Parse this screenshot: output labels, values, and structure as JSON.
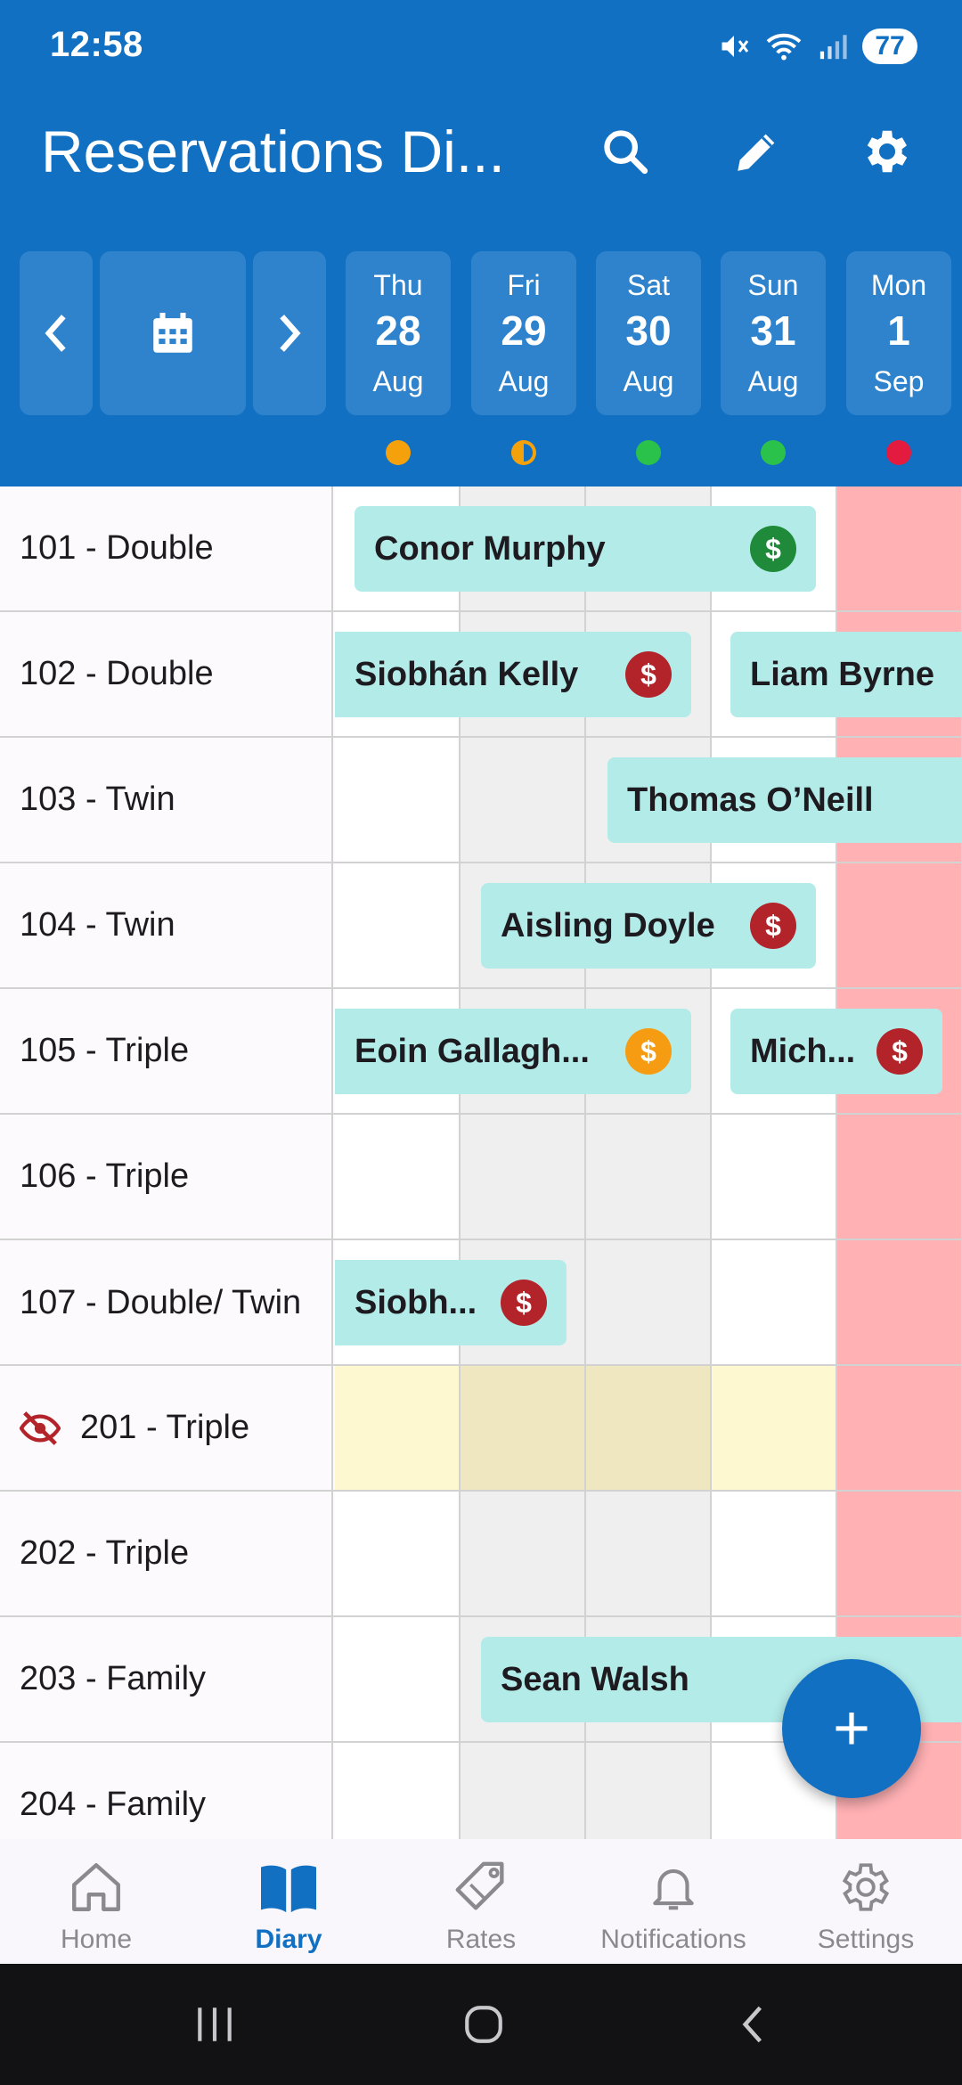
{
  "status_bar": {
    "time": "12:58",
    "battery": "77"
  },
  "app_bar": {
    "title": "Reservations Di..."
  },
  "days": [
    {
      "name": "Thu",
      "num": "28",
      "month": "Aug",
      "dot_color": "#f5a10c",
      "dot_style": "full"
    },
    {
      "name": "Fri",
      "num": "29",
      "month": "Aug",
      "dot_color": "#f5a10c",
      "dot_style": "half"
    },
    {
      "name": "Sat",
      "num": "30",
      "month": "Aug",
      "dot_color": "#2ac24a",
      "dot_style": "full"
    },
    {
      "name": "Sun",
      "num": "31",
      "month": "Aug",
      "dot_color": "#2ac24a",
      "dot_style": "full"
    },
    {
      "name": "Mon",
      "num": "1",
      "month": "Sep",
      "dot_color": "#e31b3f",
      "dot_style": "full"
    }
  ],
  "rooms": [
    {
      "label": "101 - Double"
    },
    {
      "label": "102 - Double"
    },
    {
      "label": "103 - Twin"
    },
    {
      "label": "104 - Twin"
    },
    {
      "label": "105 - Triple"
    },
    {
      "label": "106 - Triple"
    },
    {
      "label": "107 - Double/ Twin"
    },
    {
      "label": "201 - Triple",
      "hidden_icon": "eye-off-icon"
    },
    {
      "label": "202 - Triple"
    },
    {
      "label": "203 - Family"
    },
    {
      "label": "204 - Family"
    }
  ],
  "bookings": [
    {
      "guest": "Conor Murphy",
      "payment_color": "#1f8a3a",
      "payment_symbol": "$"
    },
    {
      "guest": "Siobhán Kelly",
      "payment_color": "#b3232a",
      "payment_symbol": "$"
    },
    {
      "guest": "Liam Byrne"
    },
    {
      "guest": "Thomas O’Neill"
    },
    {
      "guest": "Aisling Doyle",
      "payment_color": "#b3232a",
      "payment_symbol": "$"
    },
    {
      "guest": "Eoin Gallagh...",
      "payment_color": "#f59c12",
      "payment_symbol": "$"
    },
    {
      "guest": "Mich...",
      "payment_color": "#b3232a",
      "payment_symbol": "$"
    },
    {
      "guest": "Siobh...",
      "payment_color": "#b3232a",
      "payment_symbol": "$"
    },
    {
      "guest": "Sean Walsh"
    }
  ],
  "fab": {
    "icon": "plus-icon",
    "symbol": "+"
  },
  "bottom_nav": [
    {
      "label": "Home",
      "icon": "home-icon"
    },
    {
      "label": "Diary",
      "icon": "book-icon",
      "active": true
    },
    {
      "label": "Rates",
      "icon": "tag-icon"
    },
    {
      "label": "Notifications",
      "icon": "bell-icon"
    },
    {
      "label": "Settings",
      "icon": "gear-icon"
    }
  ],
  "colors": {
    "primary": "#1170c2",
    "booking": "#b3ebe9",
    "closed_day": "#ffb1b4",
    "hidden_room": "#fdf8cf"
  }
}
